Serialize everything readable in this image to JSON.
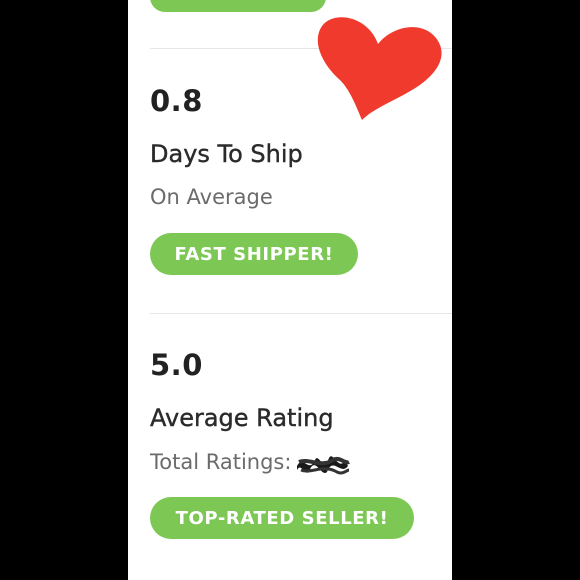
{
  "colors": {
    "accent_green": "#7dc855",
    "heart_red": "#f03a2e"
  },
  "stats": [
    {
      "value": "0.8",
      "title": "Days To Ship",
      "subtitle": "On Average",
      "badge": "FAST SHIPPER!"
    },
    {
      "value": "5.0",
      "title": "Average Rating",
      "subtitle": "Total Ratings:",
      "badge": "TOP-RATED SELLER!"
    }
  ],
  "decorations": {
    "heart_icon": "heart-icon",
    "redaction": "redacted-scribble"
  }
}
